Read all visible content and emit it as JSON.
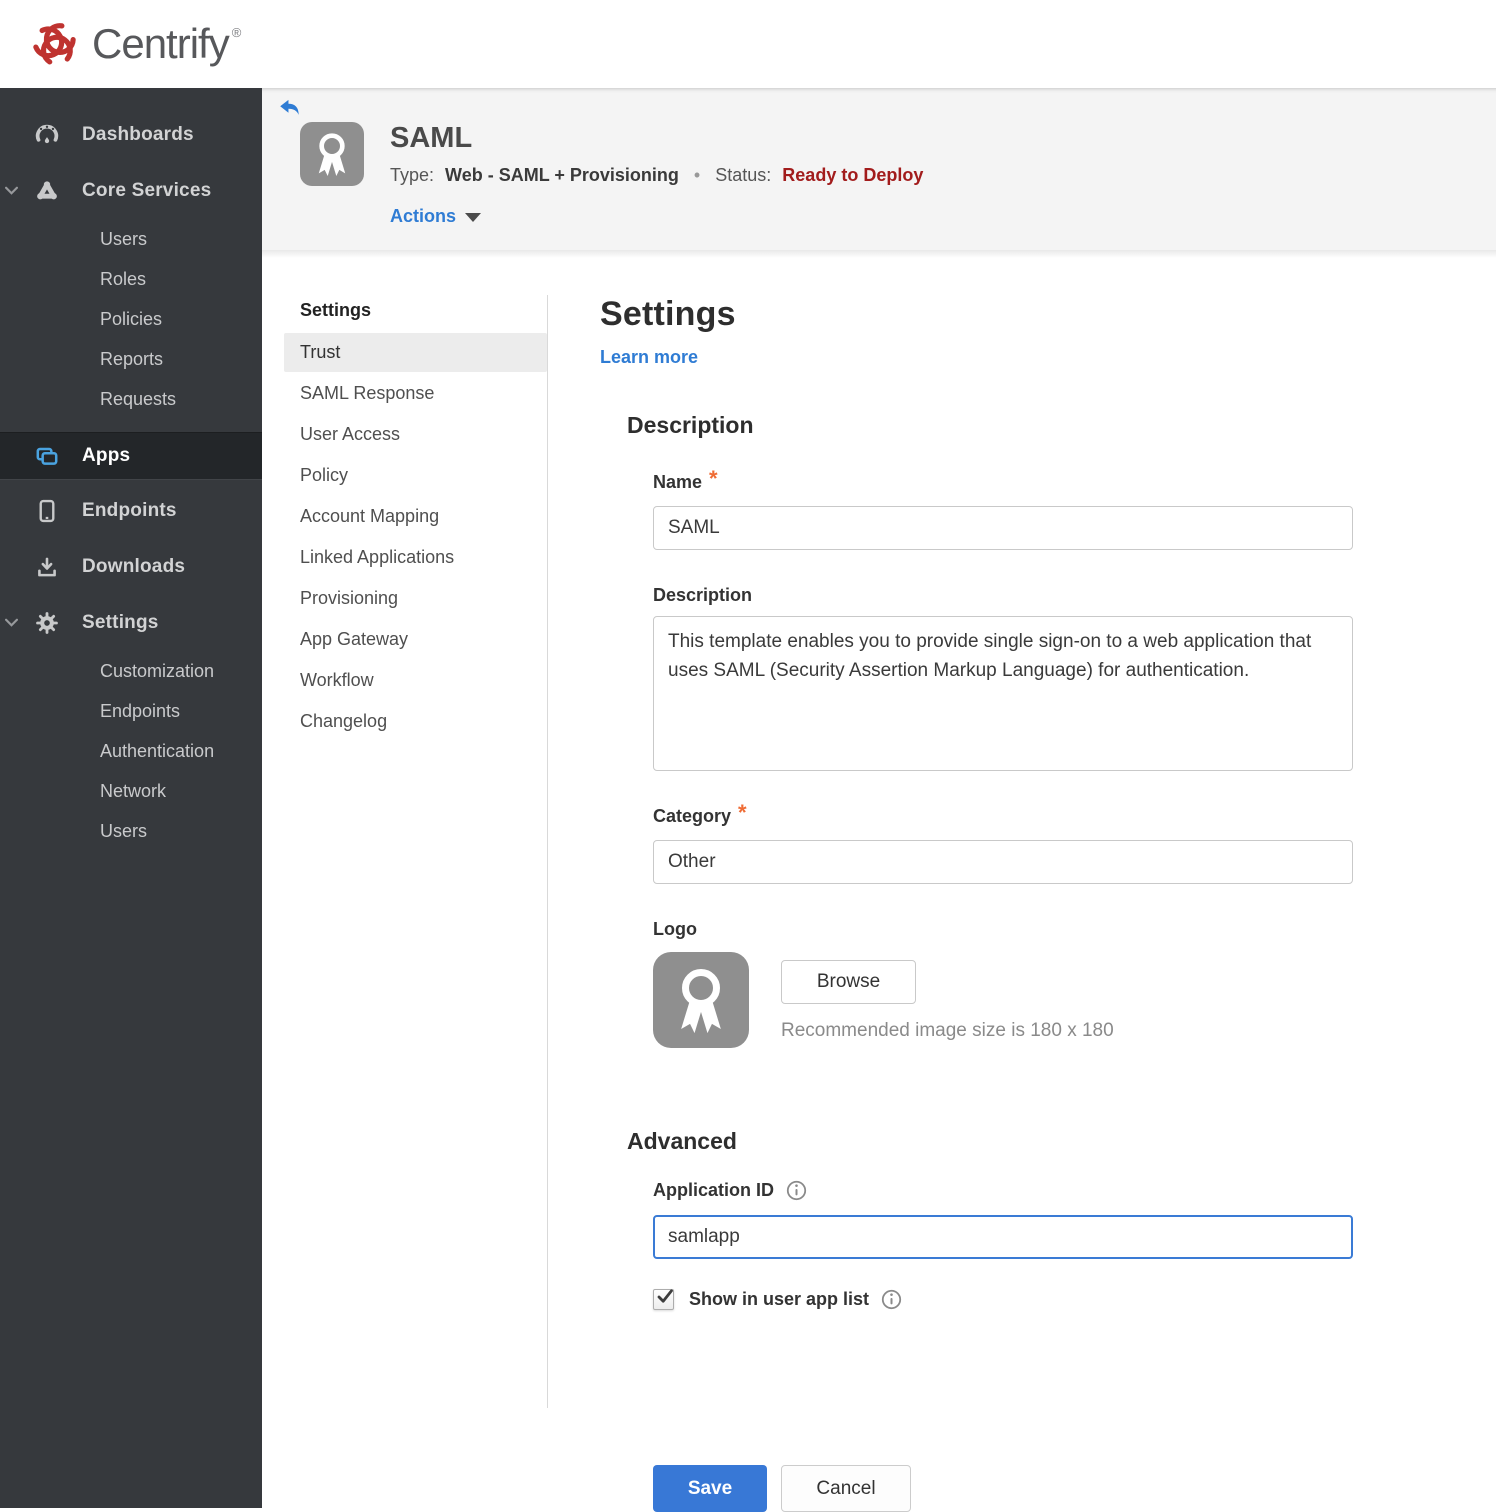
{
  "topbar": {
    "brand": "Centrify",
    "registered": "®"
  },
  "colors": {
    "accent_blue": "#3878d6",
    "link_blue": "#2f7cd4",
    "status_red": "#a21c1c",
    "required_orange": "#ef6c35",
    "sidebar_icon_blue": "#4aa3e0",
    "brand_red": "#bf3330",
    "sidebar_bg": "#36393d"
  },
  "sidebar": {
    "items": [
      {
        "label": "Dashboards",
        "icon": "gauge-icon"
      },
      {
        "label": "Core Services",
        "icon": "core-services-icon",
        "expanded": true,
        "children": [
          "Users",
          "Roles",
          "Policies",
          "Reports",
          "Requests"
        ]
      },
      {
        "label": "Apps",
        "icon": "apps-icon",
        "active": true
      },
      {
        "label": "Endpoints",
        "icon": "phone-icon"
      },
      {
        "label": "Downloads",
        "icon": "download-icon"
      },
      {
        "label": "Settings",
        "icon": "gear-icon",
        "expanded": true,
        "children": [
          "Customization",
          "Endpoints",
          "Authentication",
          "Network",
          "Users"
        ]
      }
    ]
  },
  "header": {
    "title": "SAML",
    "type_label": "Type:",
    "type_value": "Web - SAML + Provisioning",
    "separator": "•",
    "status_label": "Status:",
    "status_value": "Ready to Deploy",
    "actions_label": "Actions"
  },
  "subnav": {
    "heading": "Settings",
    "active": "Trust",
    "items": [
      "Trust",
      "SAML Response",
      "User Access",
      "Policy",
      "Account Mapping",
      "Linked Applications",
      "Provisioning",
      "App Gateway",
      "Workflow",
      "Changelog"
    ]
  },
  "main": {
    "title": "Settings",
    "learn_more": "Learn more",
    "description_section": {
      "heading": "Description",
      "name_label": "Name",
      "name_value": "SAML",
      "description_label": "Description",
      "description_value": "This template enables you to provide single sign-on to a web application that uses SAML (Security Assertion Markup Language) for authentication.",
      "category_label": "Category",
      "category_value": "Other",
      "logo_label": "Logo",
      "browse_label": "Browse",
      "logo_hint": "Recommended image size is 180 x 180"
    },
    "advanced_section": {
      "heading": "Advanced",
      "app_id_label": "Application ID",
      "app_id_value": "samlapp",
      "show_in_list_label": "Show in user app list",
      "show_in_list_checked": "checked"
    },
    "save_label": "Save",
    "cancel_label": "Cancel"
  }
}
